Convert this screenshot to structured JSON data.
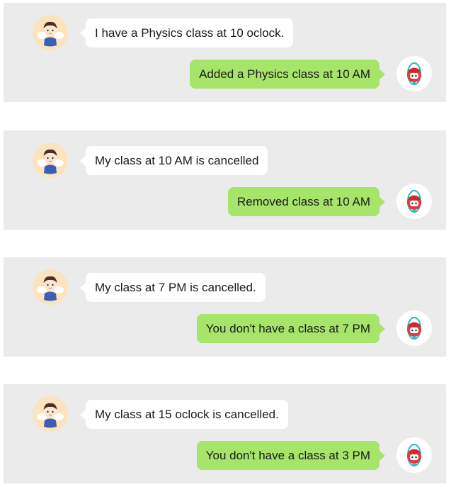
{
  "colors": {
    "panel_bg": "#ebebeb",
    "user_bubble": "#ffffff",
    "bot_bubble": "#a6e569",
    "user_avatar_bg": "#fbe3c0",
    "bot_avatar_bg": "#ffffff"
  },
  "icons": {
    "user_avatar": "angel-boy-avatar-icon",
    "bot_avatar": "red-robot-avatar-icon"
  },
  "conversations": [
    {
      "user_message": "I have a Physics class at 10 oclock.",
      "bot_reply": "Added a Physics class at 10 AM"
    },
    {
      "user_message": "My class at 10 AM is cancelled",
      "bot_reply": "Removed class at 10 AM"
    },
    {
      "user_message": "My class at 7 PM is cancelled.",
      "bot_reply": "You don't have a class at 7 PM"
    },
    {
      "user_message": "My class at 15 oclock is cancelled.",
      "bot_reply": "You don't have a class at 3 PM"
    }
  ]
}
